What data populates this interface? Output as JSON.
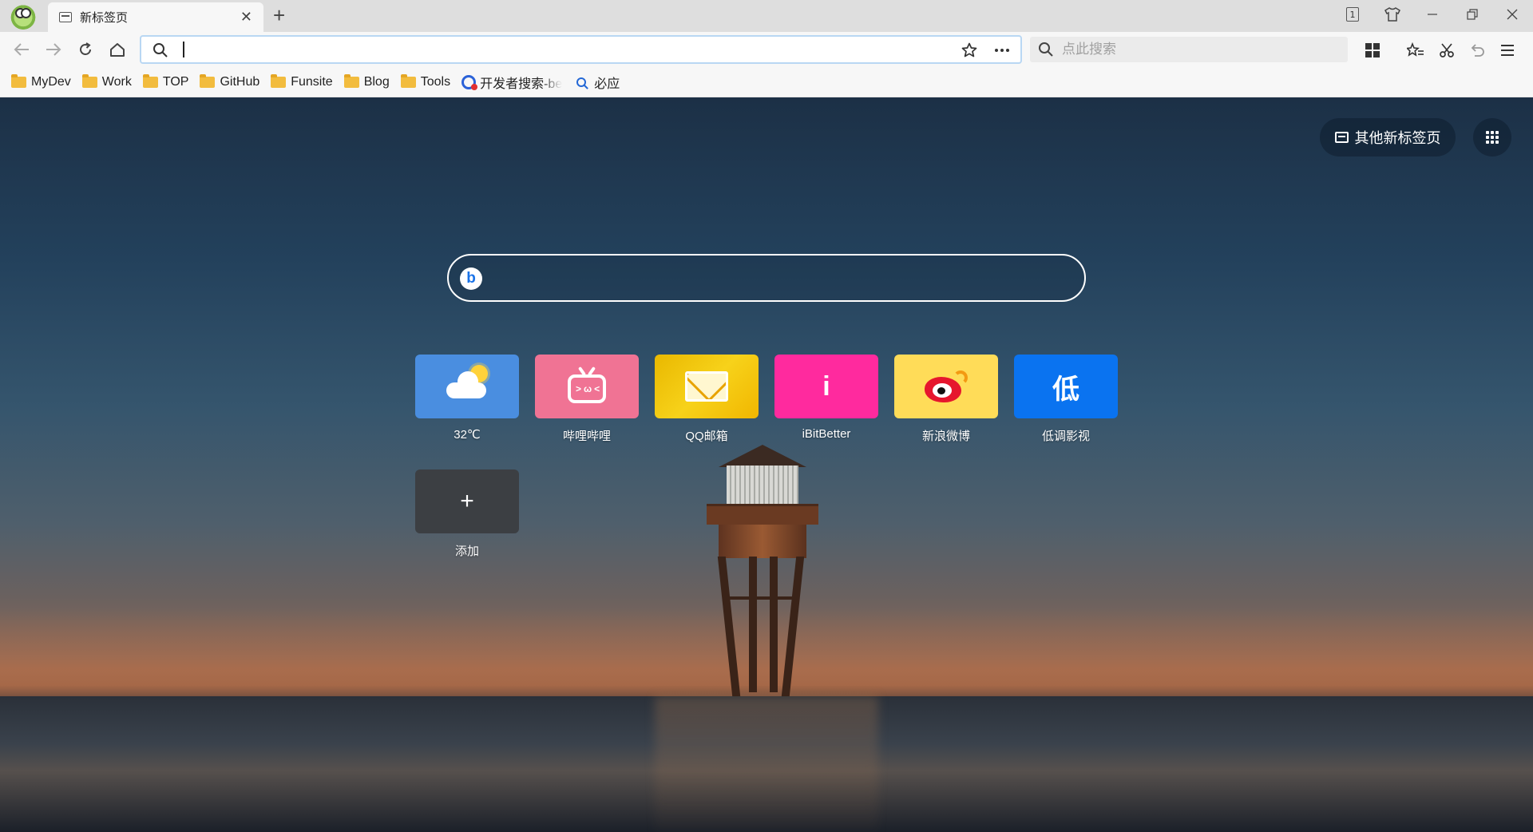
{
  "browser": {
    "tab": {
      "title": "新标签页"
    },
    "tab_count": "1"
  },
  "toolbar": {
    "address_value": "",
    "search_placeholder": "点此搜索"
  },
  "bookmarks": [
    {
      "label": "MyDev",
      "type": "folder"
    },
    {
      "label": "Work",
      "type": "folder"
    },
    {
      "label": "TOP",
      "type": "folder"
    },
    {
      "label": "GitHub",
      "type": "folder"
    },
    {
      "label": "Funsite",
      "type": "folder"
    },
    {
      "label": "Blog",
      "type": "folder"
    },
    {
      "label": "Tools",
      "type": "folder"
    },
    {
      "label": "开发者搜索-be",
      "type": "link"
    },
    {
      "label": "必应",
      "type": "link"
    }
  ],
  "newtab": {
    "other_tabs_label": "其他新标签页",
    "search_value": "",
    "tiles": [
      {
        "label": "32℃",
        "icon": "weather-icon",
        "color": "#4a8ee0"
      },
      {
        "label": "哔哩哔哩",
        "icon": "bilibili-icon",
        "color": "#f07394"
      },
      {
        "label": "QQ邮箱",
        "icon": "mail-icon",
        "color": "#f5c400"
      },
      {
        "label": "iBitBetter",
        "icon": "letter-i-icon",
        "glyph": "i",
        "color": "#ff2a9e"
      },
      {
        "label": "新浪微博",
        "icon": "weibo-icon",
        "color": "#ffdc58"
      },
      {
        "label": "低调影视",
        "icon": "dd-video-icon",
        "glyph": "低",
        "color": "#0a73f0"
      }
    ],
    "add_tile": {
      "label": "添加",
      "color": "#3c3f43"
    }
  }
}
